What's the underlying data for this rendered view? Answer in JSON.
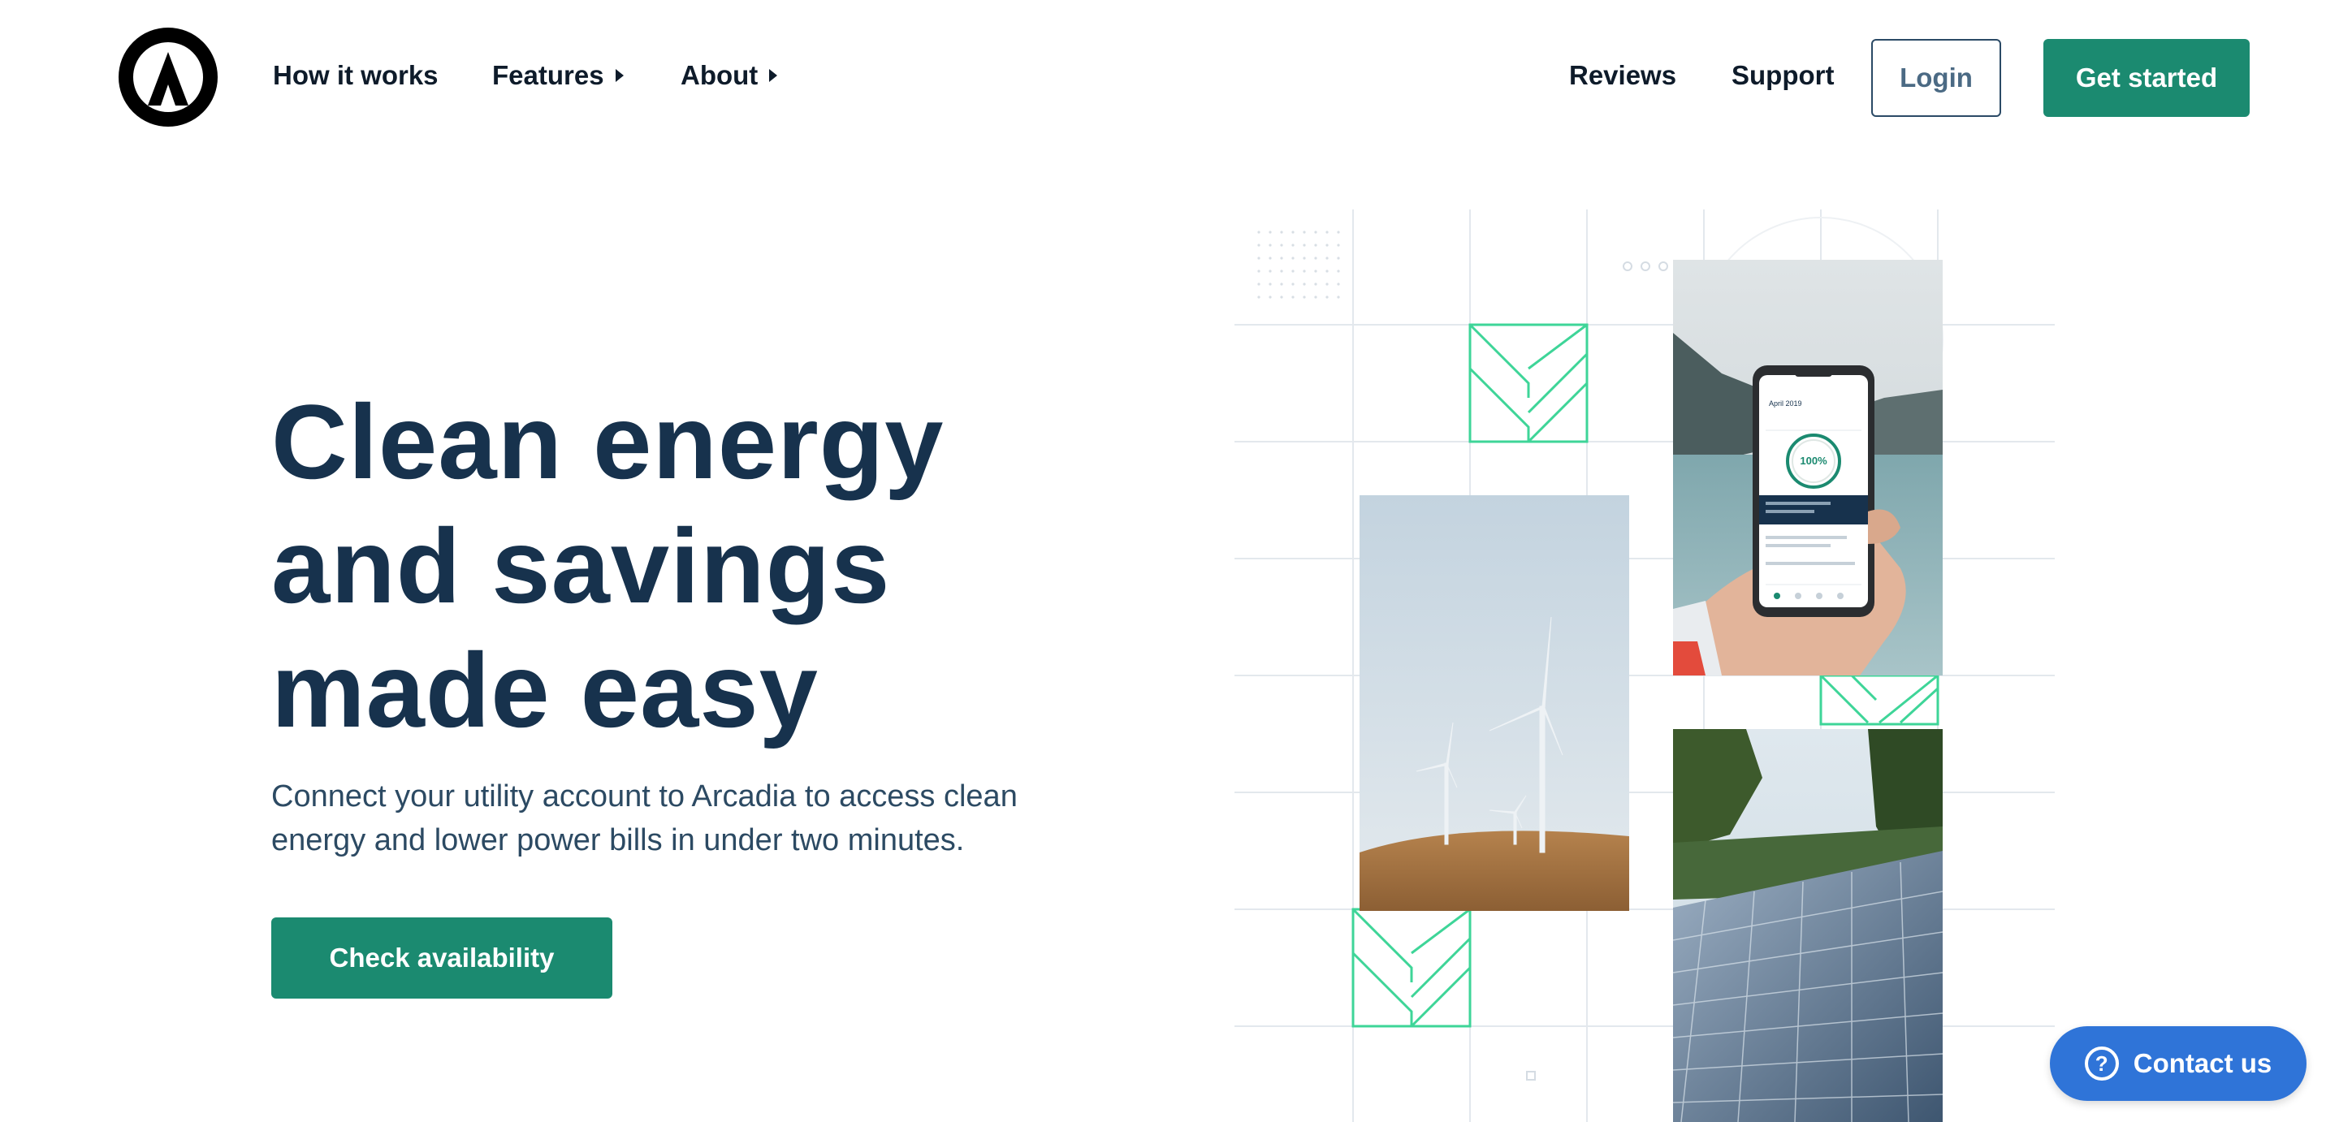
{
  "nav": {
    "items": [
      {
        "label": "How it works"
      },
      {
        "label": "Features"
      },
      {
        "label": "About"
      }
    ],
    "right": {
      "reviews": "Reviews",
      "support": "Support",
      "login": "Login",
      "get_started": "Get started"
    }
  },
  "hero": {
    "title_lines": [
      "Clean energy",
      "and savings",
      "made easy"
    ],
    "subtitle_lines": [
      "Connect your utility account to Arcadia to access clean",
      "energy and lower power bills in under two minutes."
    ],
    "cta": "Check availability"
  },
  "phone": {
    "date": "April 2019",
    "percent": "100%"
  },
  "contact": {
    "label": "Contact us",
    "icon": "question-circle-icon"
  },
  "colors": {
    "primary": "#1b8a70",
    "navy": "#17324d",
    "accent_green": "#3ed598",
    "contact_blue": "#2f74d8"
  }
}
